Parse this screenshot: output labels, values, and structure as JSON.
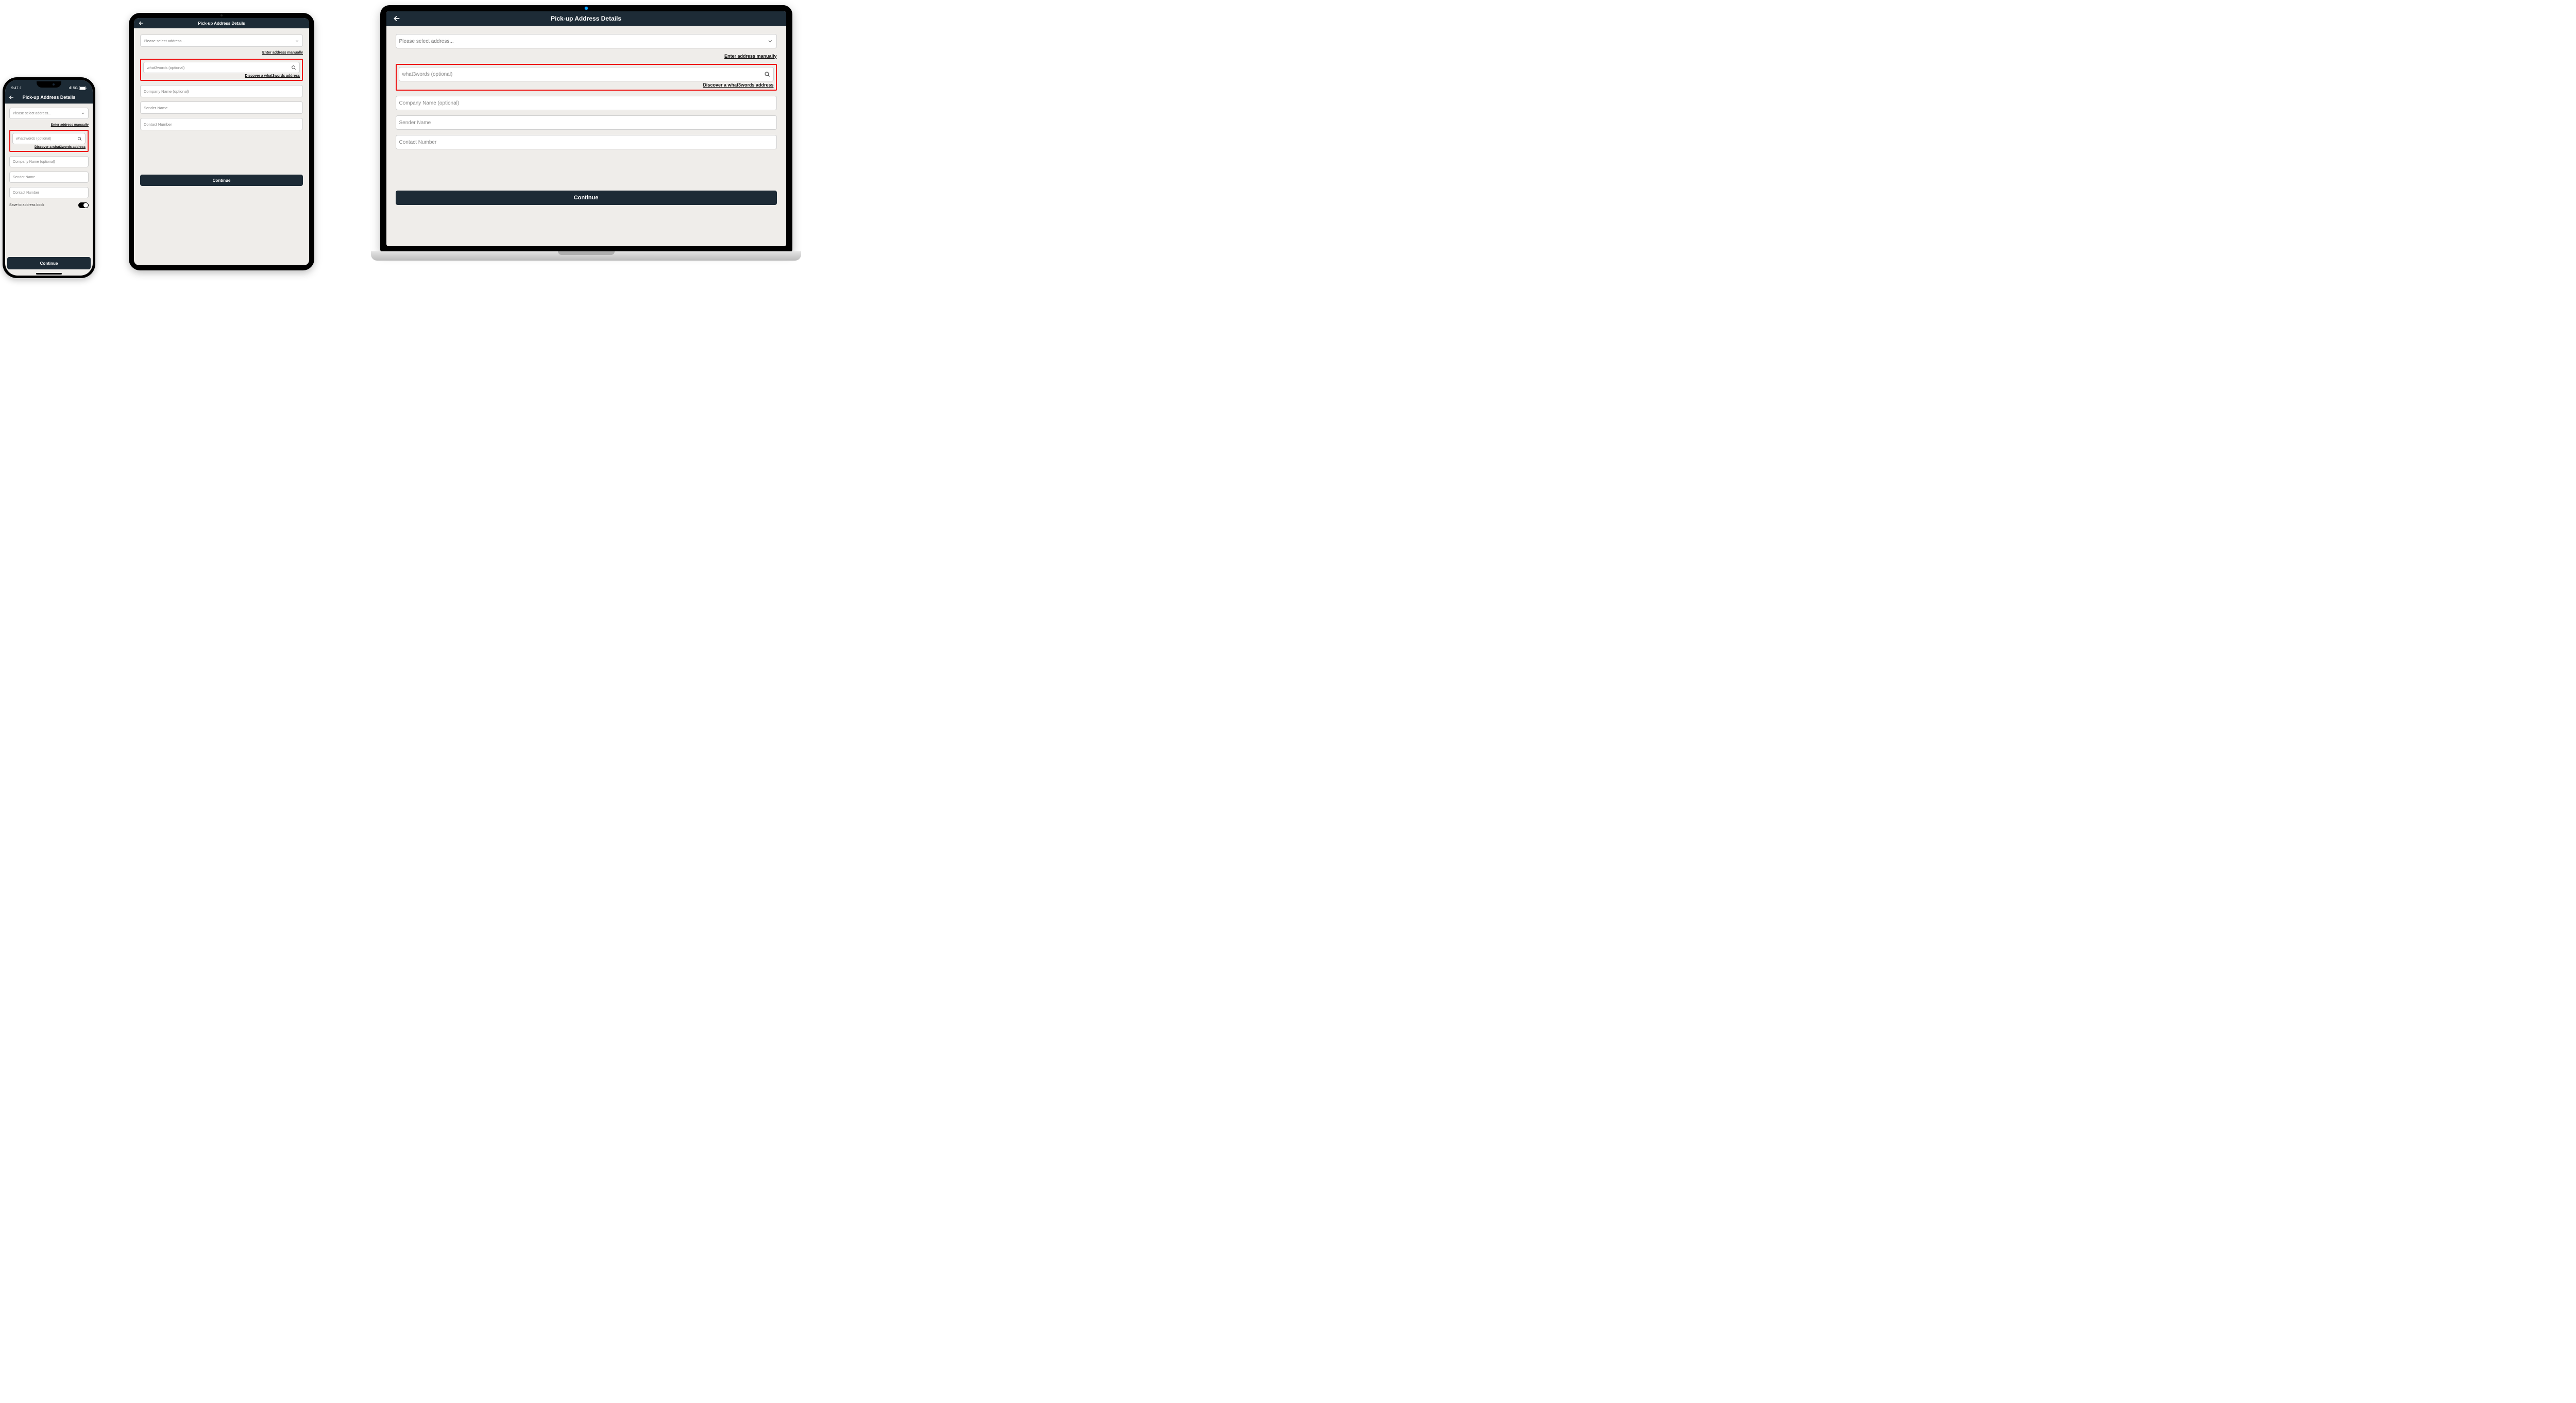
{
  "status": {
    "time": "9:47",
    "moon": "☾",
    "signal": "•ıll",
    "network": "5G",
    "battery": "▮"
  },
  "header": {
    "title": "Pick-up Address Details"
  },
  "form": {
    "address_select_placeholder": "Please select address...",
    "enter_manually_link": "Enter address manually",
    "w3w_placeholder": "what3words (optional)",
    "discover_w3w_link": "Discover a what3words address",
    "company_placeholder": "Company Name (optional)",
    "sender_placeholder": "Sender Name",
    "contact_placeholder": "Contact Number",
    "save_to_book_label": "Save to address book",
    "continue_label": "Continue"
  }
}
